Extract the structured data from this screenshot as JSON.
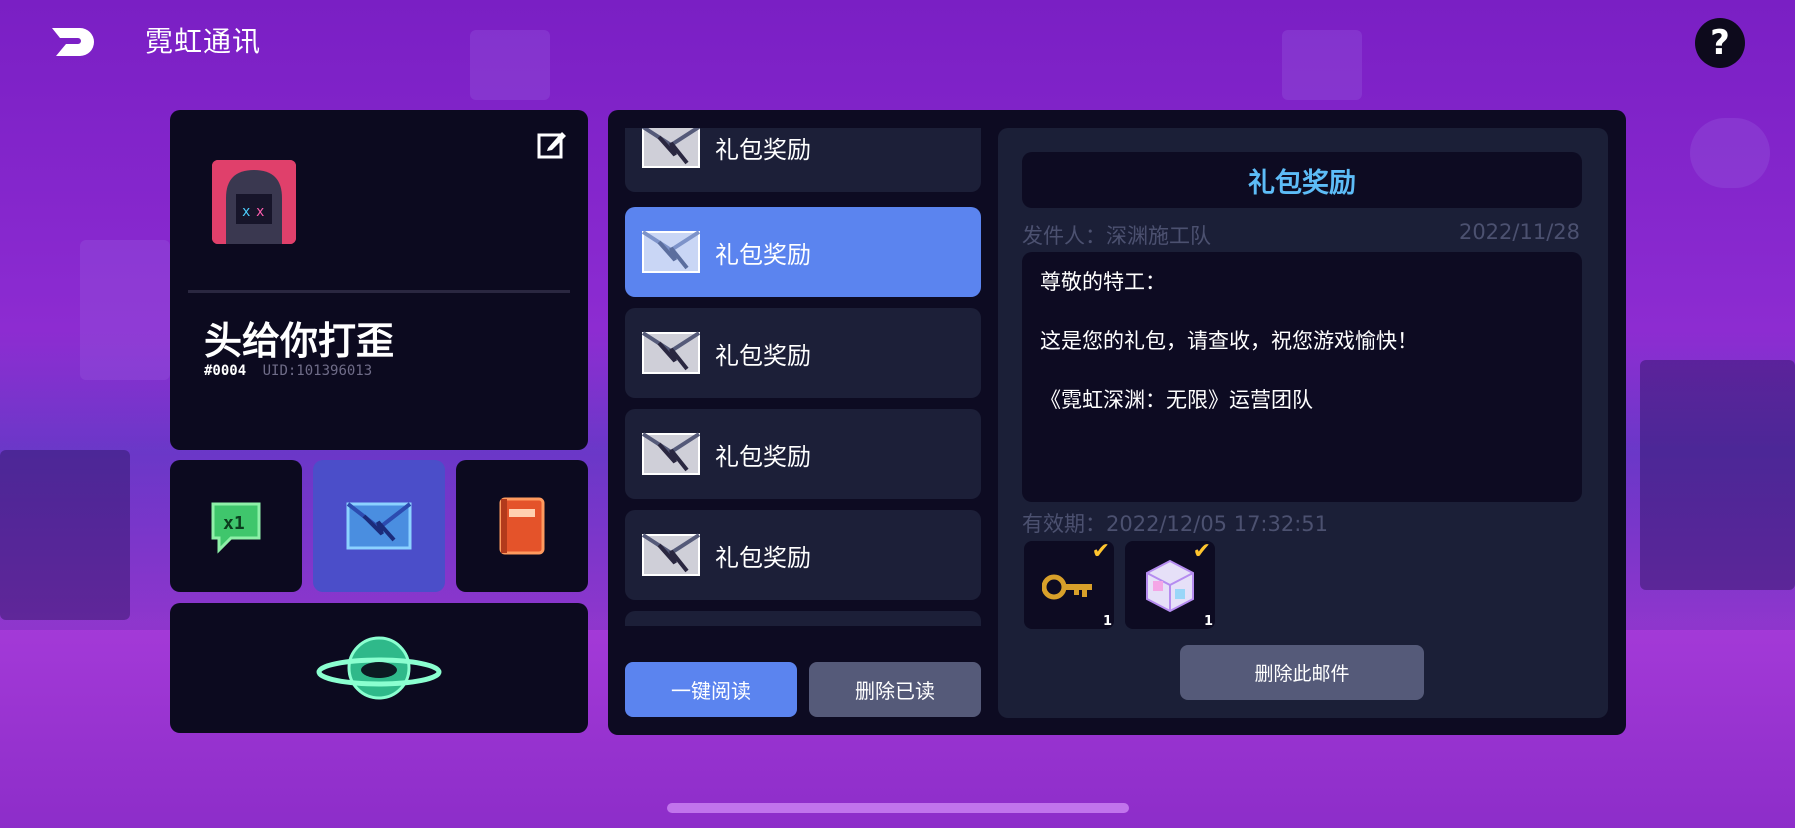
{
  "header": {
    "title": "霓虹通讯",
    "back_icon": "back-arrow-icon",
    "help_label": "?"
  },
  "profile": {
    "nickname": "头给你打歪",
    "tag": "#0004",
    "uid": "UID:101396013"
  },
  "mail_list": {
    "items": [
      {
        "label": "礼包奖励",
        "selected": false
      },
      {
        "label": "礼包奖励",
        "selected": true
      },
      {
        "label": "礼包奖励",
        "selected": false
      },
      {
        "label": "礼包奖励",
        "selected": false
      },
      {
        "label": "礼包奖励",
        "selected": false
      }
    ],
    "read_all_label": "一键阅读",
    "delete_read_label": "删除已读"
  },
  "mail_detail": {
    "subject": "礼包奖励",
    "sender": "发件人：深渊施工队",
    "date": "2022/11/28",
    "body": [
      "尊敬的特工：",
      "这是您的礼包，请查收，祝您游戏愉快！",
      "《霓虹深渊：无限》运营团队"
    ],
    "expiry": "有效期：2022/12/05 17:32:51",
    "rewards": [
      {
        "icon": "key-icon",
        "count": "1",
        "claimed": true
      },
      {
        "icon": "crystal-cube-icon",
        "count": "1",
        "claimed": true
      }
    ],
    "delete_label": "删除此邮件"
  },
  "colors": {
    "accent_blue": "#5b84ef",
    "subject_blue": "#5dbcf7",
    "check_gold": "#ffc52e",
    "panel": "#0c0a1f"
  }
}
